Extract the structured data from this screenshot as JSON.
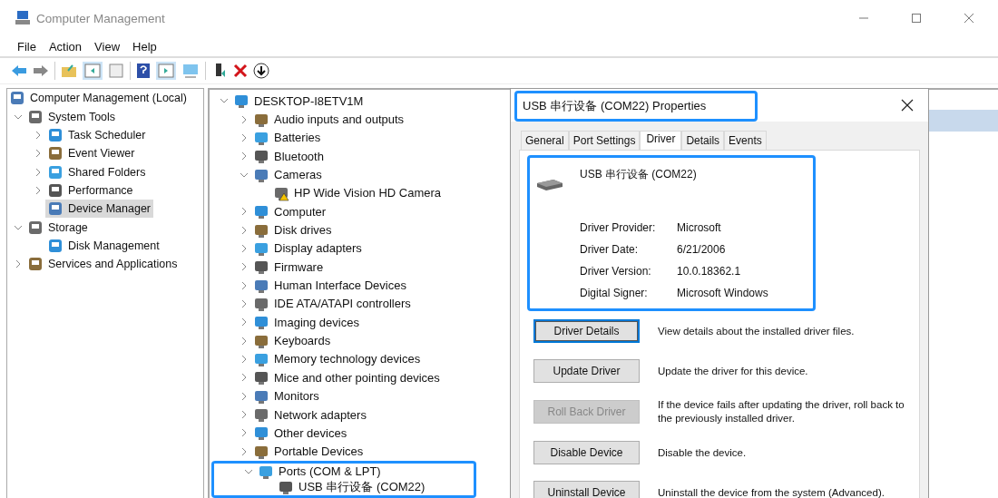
{
  "window": {
    "title": "Computer Management"
  },
  "menu": [
    "File",
    "Action",
    "View",
    "Help"
  ],
  "nav_tree": [
    {
      "label": "Computer Management (Local)",
      "kind": "root",
      "selected": false,
      "children": [
        {
          "label": "System Tools",
          "kind": "expanded",
          "selected": false,
          "children": [
            {
              "label": "Task Scheduler",
              "kind": "collapsed",
              "selected": false
            },
            {
              "label": "Event Viewer",
              "kind": "collapsed",
              "selected": false
            },
            {
              "label": "Shared Folders",
              "kind": "collapsed",
              "selected": false
            },
            {
              "label": "Performance",
              "kind": "collapsed",
              "selected": false
            },
            {
              "label": "Device Manager",
              "kind": "leaf",
              "selected": true
            }
          ]
        },
        {
          "label": "Storage",
          "kind": "expanded",
          "selected": false,
          "children": [
            {
              "label": "Disk Management",
              "kind": "leaf",
              "selected": false
            }
          ]
        },
        {
          "label": "Services and Applications",
          "kind": "collapsed",
          "selected": false
        }
      ]
    }
  ],
  "device_tree": [
    {
      "label": "DESKTOP-I8ETV1M",
      "kind": "expanded",
      "highlighted": false,
      "children": [
        {
          "label": "Audio inputs and outputs",
          "kind": "collapsed",
          "highlighted": false
        },
        {
          "label": "Batteries",
          "kind": "collapsed",
          "highlighted": false
        },
        {
          "label": "Bluetooth",
          "kind": "collapsed",
          "highlighted": false
        },
        {
          "label": "Cameras",
          "kind": "expanded",
          "highlighted": false,
          "children": [
            {
              "label": "HP Wide Vision HD Camera",
              "kind": "leaf",
              "highlighted": false,
              "warning": true
            }
          ]
        },
        {
          "label": "Computer",
          "kind": "collapsed",
          "highlighted": false
        },
        {
          "label": "Disk drives",
          "kind": "collapsed",
          "highlighted": false
        },
        {
          "label": "Display adapters",
          "kind": "collapsed",
          "highlighted": false
        },
        {
          "label": "Firmware",
          "kind": "collapsed",
          "highlighted": false
        },
        {
          "label": "Human Interface Devices",
          "kind": "collapsed",
          "highlighted": false
        },
        {
          "label": "IDE ATA/ATAPI controllers",
          "kind": "collapsed",
          "highlighted": false
        },
        {
          "label": "Imaging devices",
          "kind": "collapsed",
          "highlighted": false
        },
        {
          "label": "Keyboards",
          "kind": "collapsed",
          "highlighted": false
        },
        {
          "label": "Memory technology devices",
          "kind": "collapsed",
          "highlighted": false
        },
        {
          "label": "Mice and other pointing devices",
          "kind": "collapsed",
          "highlighted": false
        },
        {
          "label": "Monitors",
          "kind": "collapsed",
          "highlighted": false
        },
        {
          "label": "Network adapters",
          "kind": "collapsed",
          "highlighted": false
        },
        {
          "label": "Other devices",
          "kind": "collapsed",
          "highlighted": false
        },
        {
          "label": "Portable Devices",
          "kind": "collapsed",
          "highlighted": false
        },
        {
          "label": "Ports (COM & LPT)",
          "kind": "expanded",
          "highlighted": true,
          "children": [
            {
              "label": "USB 串行设备 (COM22)",
              "kind": "leaf",
              "highlighted": false
            }
          ]
        }
      ]
    }
  ],
  "dialog": {
    "title": "USB 串行设备 (COM22) Properties",
    "title_highlighted": true,
    "tabs": [
      {
        "label": "General",
        "selected": false
      },
      {
        "label": "Port Settings",
        "selected": false
      },
      {
        "label": "Driver",
        "selected": true
      },
      {
        "label": "Details",
        "selected": false
      },
      {
        "label": "Events",
        "selected": false
      }
    ],
    "info_highlighted": true,
    "device_name": "USB 串行设备 (COM22)",
    "properties": [
      {
        "label": "Driver Provider:",
        "value": "Microsoft"
      },
      {
        "label": "Driver Date:",
        "value": "6/21/2006"
      },
      {
        "label": "Driver Version:",
        "value": "10.0.18362.1"
      },
      {
        "label": "Digital Signer:",
        "value": "Microsoft Windows"
      }
    ],
    "actions": [
      {
        "button": "Driver Details",
        "description": "View details about the installed driver files.",
        "disabled": false,
        "focused": true
      },
      {
        "button": "Update Driver",
        "description": "Update the driver for this device.",
        "disabled": false,
        "focused": false
      },
      {
        "button": "Roll Back Driver",
        "description": "If the device fails after updating the driver, roll back to the previously installed driver.",
        "disabled": true,
        "focused": false
      },
      {
        "button": "Disable Device",
        "description": "Disable the device.",
        "disabled": false,
        "focused": false
      },
      {
        "button": "Uninstall Device",
        "description": "Uninstall the device from the system (Advanced).",
        "disabled": false,
        "focused": false
      }
    ]
  }
}
